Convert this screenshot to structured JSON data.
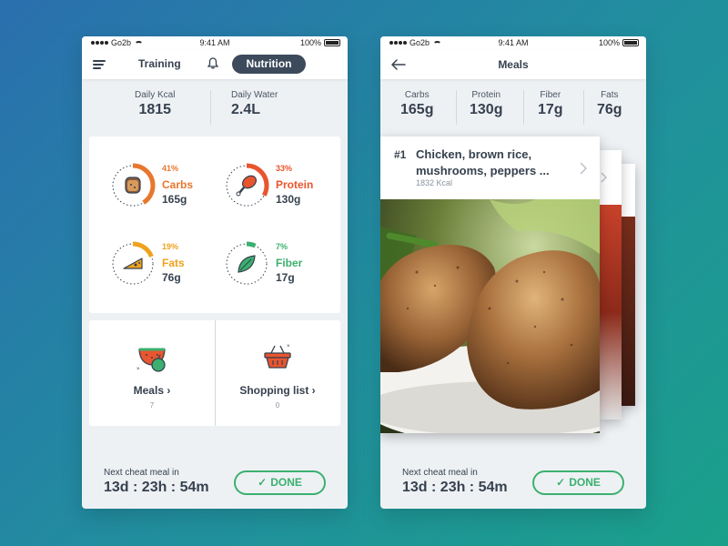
{
  "status_bar": {
    "carrier": "Go2b",
    "time": "9:41 AM",
    "battery": "100%"
  },
  "left_screen": {
    "nav": {
      "training": "Training",
      "nutrition": "Nutrition"
    },
    "summary": {
      "kcal_label": "Daily Kcal",
      "kcal_value": "1815",
      "water_label": "Daily Water",
      "water_value": "2.4L"
    },
    "macros": [
      {
        "name": "Carbs",
        "percent": "41%",
        "grams": "165g",
        "color": "#e8772e",
        "fraction": 0.41,
        "icon": "bread-icon"
      },
      {
        "name": "Protein",
        "percent": "33%",
        "grams": "130g",
        "color": "#e8552e",
        "fraction": 0.33,
        "icon": "chicken-leg-icon"
      },
      {
        "name": "Fats",
        "percent": "19%",
        "grams": "76g",
        "color": "#f0a21c",
        "fraction": 0.19,
        "icon": "cheese-icon"
      },
      {
        "name": "Fiber",
        "percent": "7%",
        "grams": "17g",
        "color": "#3bb06f",
        "fraction": 0.07,
        "icon": "spinach-leaf-icon"
      }
    ],
    "tiles": [
      {
        "label": "Meals",
        "count": "7"
      },
      {
        "label": "Shopping list",
        "count": "0"
      }
    ],
    "footer": {
      "label": "Next cheat meal in",
      "countdown": "13d : 23h : 54m",
      "button": "DONE"
    }
  },
  "right_screen": {
    "nav": {
      "title": "Meals"
    },
    "summary": [
      {
        "label": "Carbs",
        "value": "165g"
      },
      {
        "label": "Protein",
        "value": "130g"
      },
      {
        "label": "Fiber",
        "value": "17g"
      },
      {
        "label": "Fats",
        "value": "76g"
      }
    ],
    "meal": {
      "number": "#1",
      "name": "Chicken, brown rice, mushrooms, peppers ...",
      "kcal": "1832 Kcal"
    },
    "footer": {
      "label": "Next cheat meal in",
      "countdown": "13d : 23h : 54m",
      "button": "DONE"
    }
  },
  "colors": {
    "accent_green": "#3bb06f",
    "dark": "#36414f",
    "nav_pill": "#3c4a5c",
    "background_card": "#ffffff"
  }
}
